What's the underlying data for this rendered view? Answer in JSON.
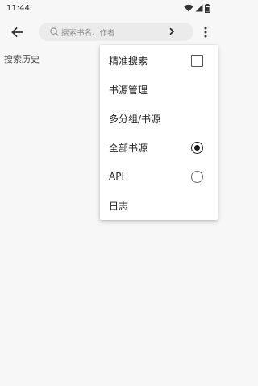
{
  "status_bar": {
    "time": "11:44",
    "icons": [
      "wifi-icon",
      "signal-icon",
      "battery-icon"
    ]
  },
  "search": {
    "placeholder": "搜索书名、作者",
    "value": ""
  },
  "history": {
    "label": "搜索历史"
  },
  "menu": {
    "items": [
      {
        "label": "精准搜索",
        "control": "checkbox",
        "checked": false
      },
      {
        "label": "书源管理",
        "control": "none"
      },
      {
        "label": "多分组/书源",
        "control": "none"
      },
      {
        "label": "全部书源",
        "control": "radio",
        "checked": true
      },
      {
        "label": "API",
        "control": "radio",
        "checked": false
      },
      {
        "label": "日志",
        "control": "none"
      }
    ]
  },
  "colors": {
    "background": "#f7f7f7",
    "search_bg": "#ebebeb",
    "menu_bg": "#ffffff",
    "text": "#212121"
  }
}
